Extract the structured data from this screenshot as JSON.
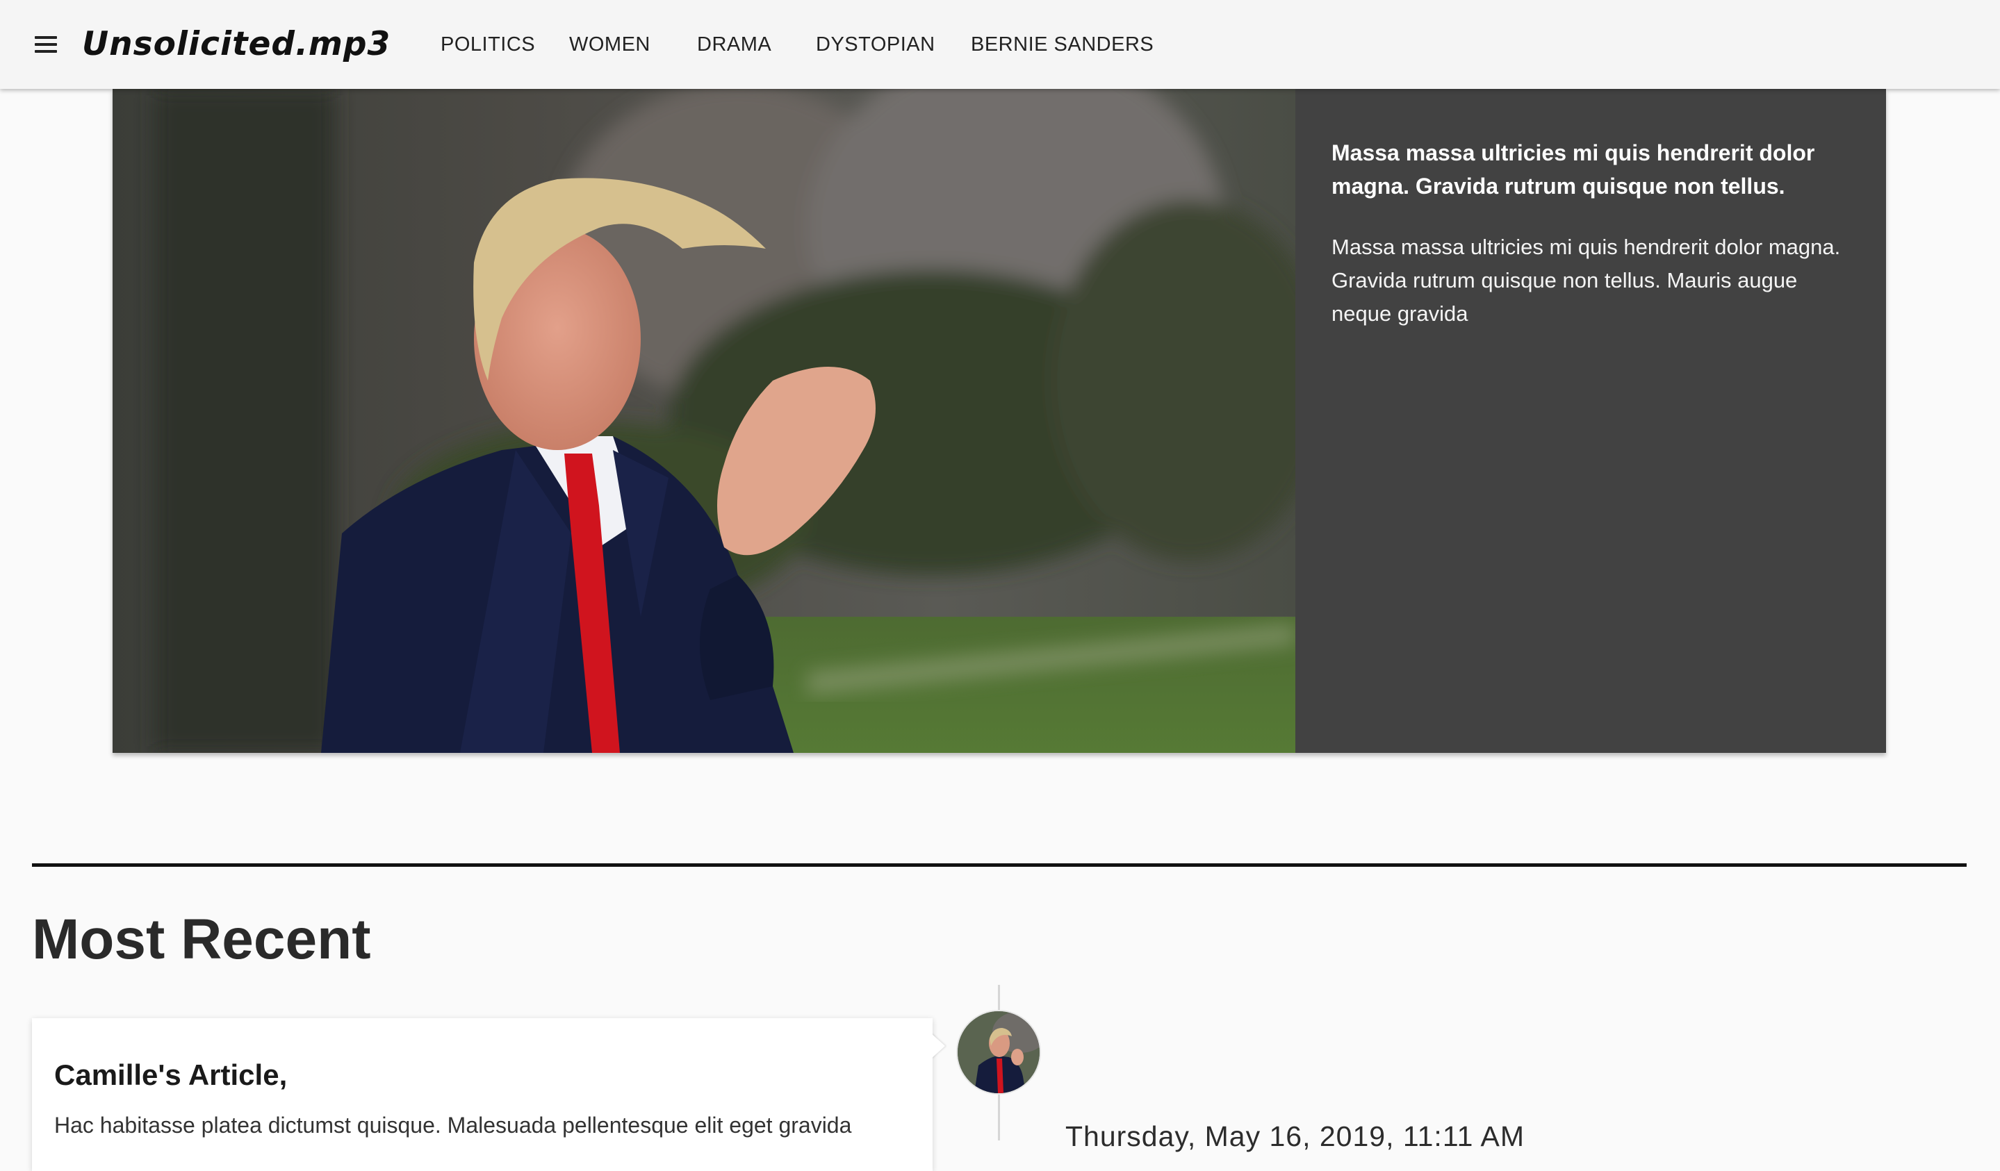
{
  "header": {
    "logo": "Unsolicited.mp3",
    "nav": [
      "POLITICS",
      "WOMEN",
      "DRAMA",
      "DYSTOPIAN",
      "BERNIE SANDERS"
    ]
  },
  "hero": {
    "lead": "Massa massa ultricies mi quis hendrerit dolor magna. Gravida rutrum quisque non tellus.",
    "body": "Massa massa ultricies mi quis hendrerit dolor magna. Gravida rutrum quisque non tellus. Mauris augue neque gravida"
  },
  "recent": {
    "title": "Most Recent",
    "items": [
      {
        "title": "Camille's Article,",
        "excerpt": "Hac habitasse platea dictumst quisque. Malesuada pellentesque elit eget gravida",
        "date": "Thursday, May 16, 2019, 11:11 AM"
      }
    ]
  },
  "colors": {
    "header_bg": "#f5f5f5",
    "panel_bg": "#424242",
    "page_bg": "#fafafa",
    "tie_red": "#d0141e",
    "suit_navy": "#151c3c"
  }
}
